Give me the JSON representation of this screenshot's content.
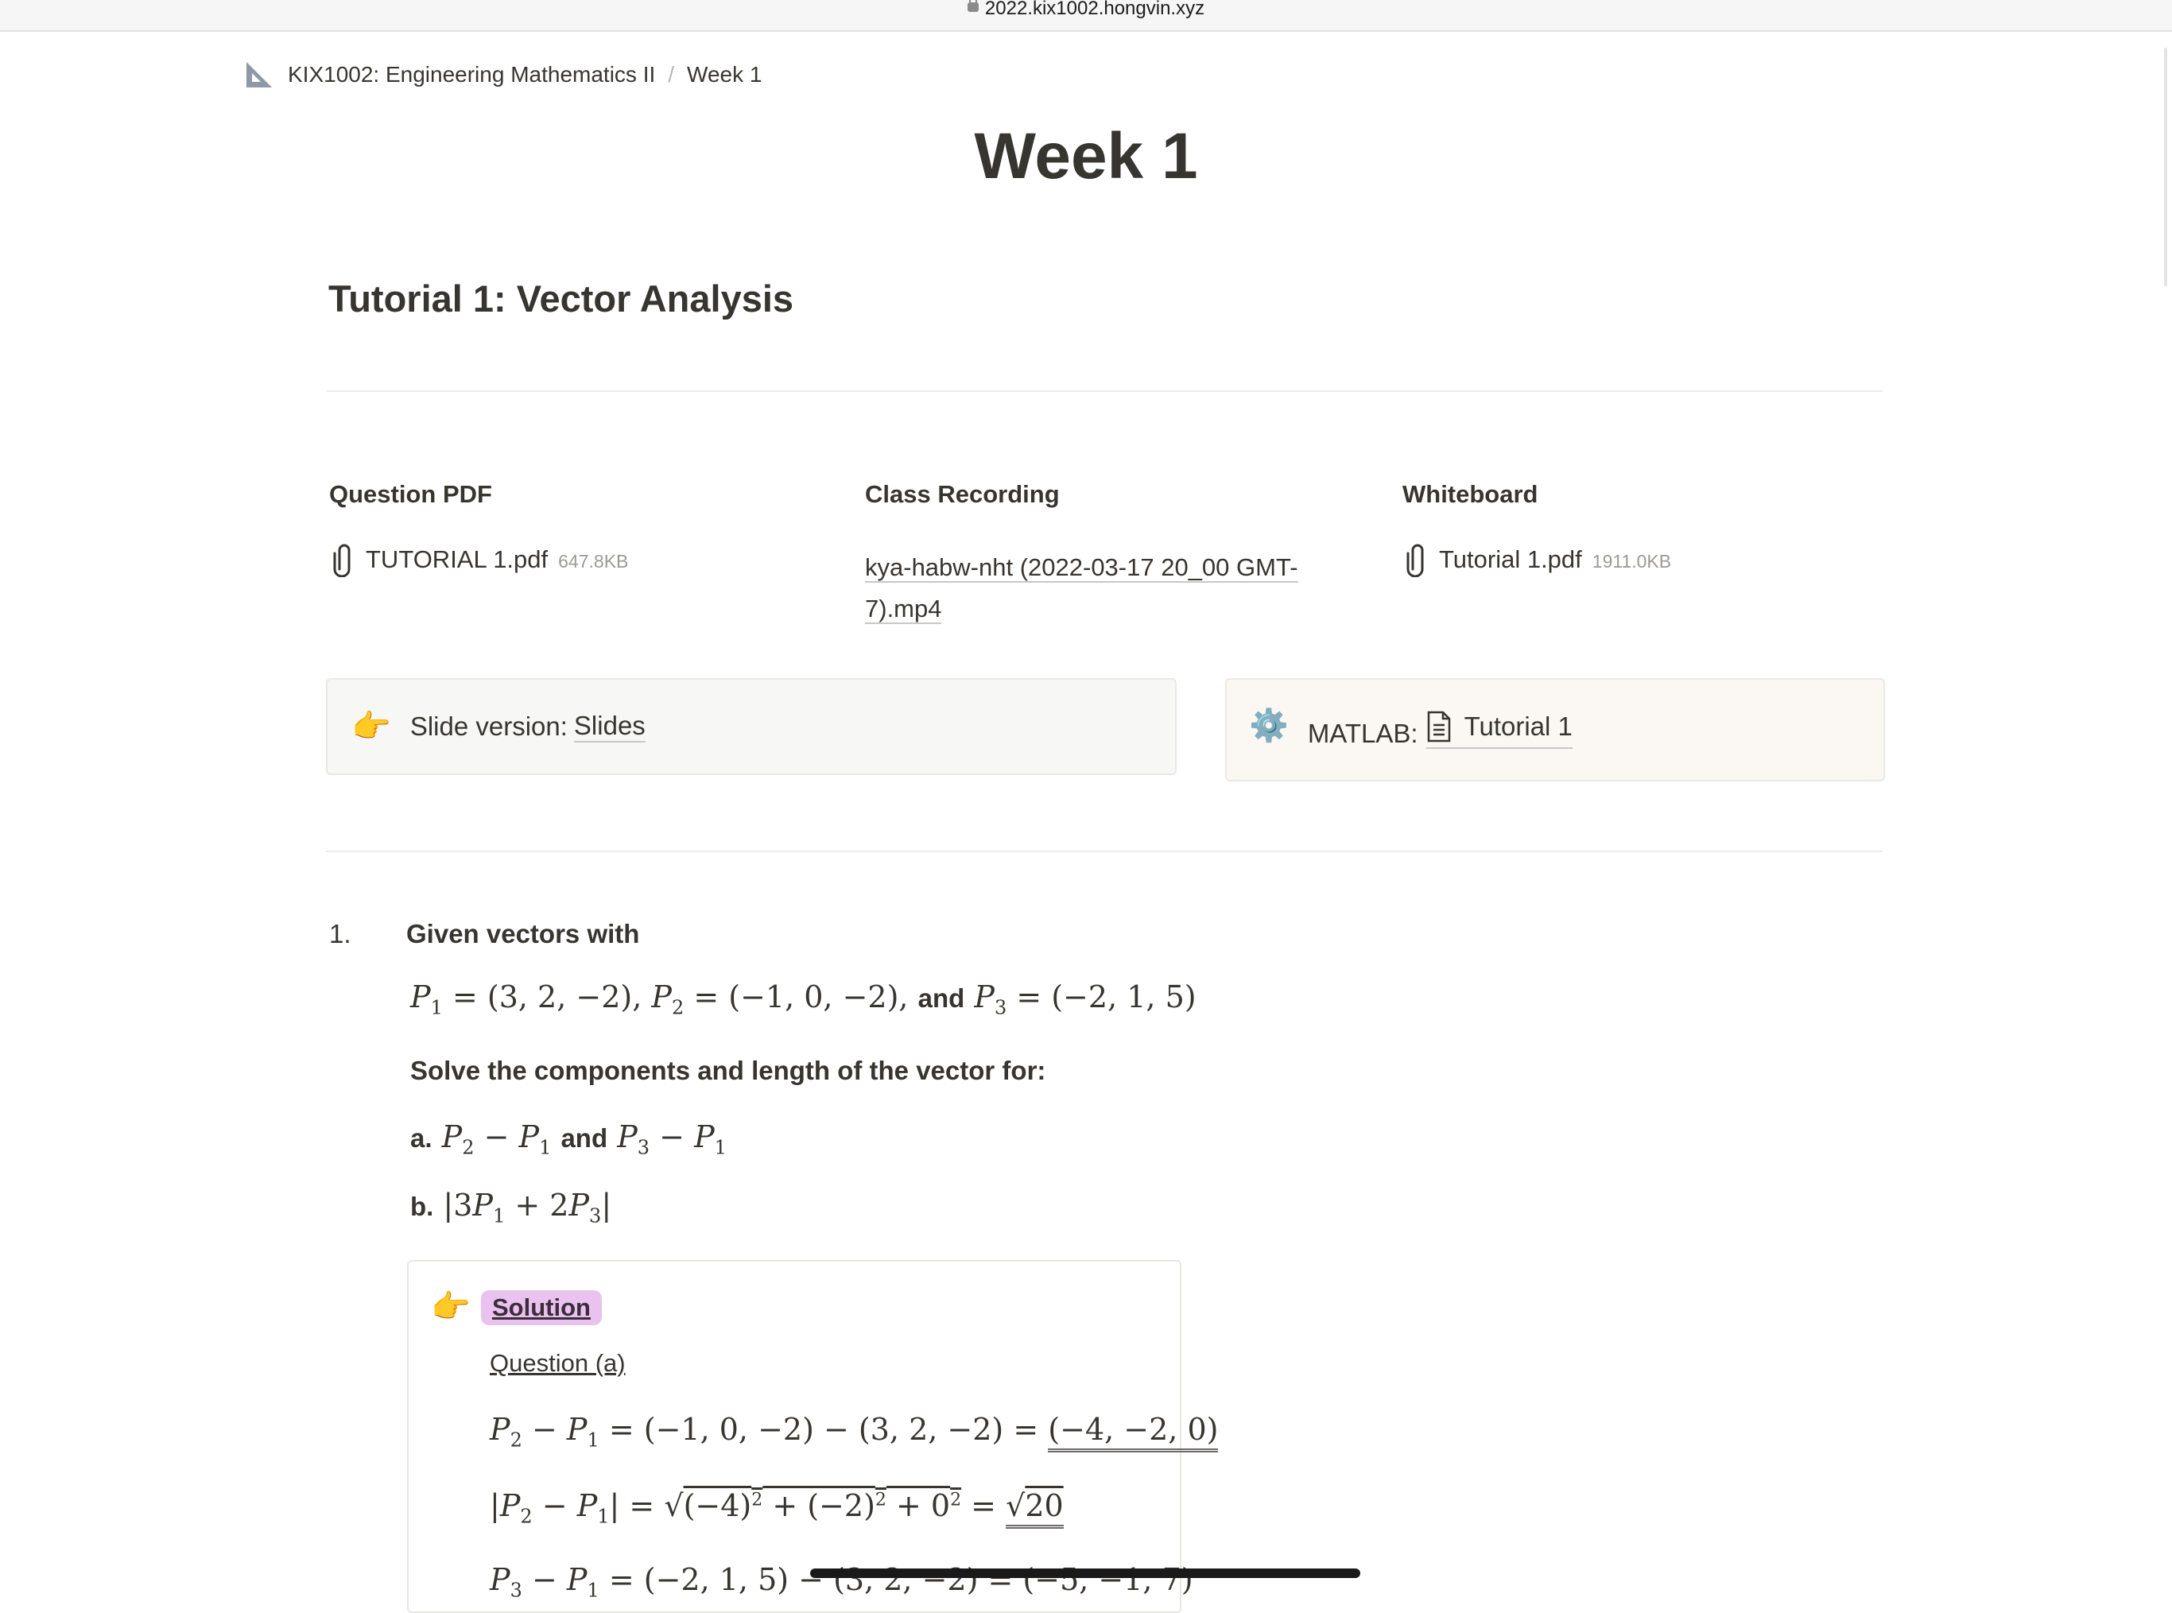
{
  "browser": {
    "url": "2022.kix1002.hongvin.xyz"
  },
  "breadcrumb": {
    "course": "KIX1002: Engineering Mathematics II",
    "separator": "/",
    "page": "Week 1"
  },
  "page_title": "Week 1",
  "tutorial_heading": "Tutorial 1: Vector Analysis",
  "columns": {
    "question": {
      "heading": "Question PDF",
      "file": "TUTORIAL 1.pdf",
      "size": "647.8KB"
    },
    "recording": {
      "heading": "Class Recording",
      "file": "kya-habw-nht (2022-03-17 20_00 GMT-7).mp4"
    },
    "whiteboard": {
      "heading": "Whiteboard",
      "file": "Tutorial 1.pdf",
      "size": "1911.0KB"
    }
  },
  "callouts": {
    "slides": {
      "emoji": "👉",
      "text": "Slide version: ",
      "link": "Slides"
    },
    "matlab": {
      "emoji": "⚙️",
      "text": "MATLAB: ",
      "link": "Tutorial 1"
    }
  },
  "question1": {
    "number": "1.",
    "intro": "Given vectors with",
    "and_word": "and",
    "instruction": "Solve the components and length of the vector for:",
    "part_a_label": "a.",
    "part_b_label": "b."
  },
  "solution": {
    "emoji": "👉",
    "label": "Solution",
    "question_a": "Question (a)"
  },
  "colors": {
    "solution_highlight": "#e9c2f0",
    "callout_slide_bg": "#f7f7f5",
    "callout_matlab_bg": "#fbf8f4"
  }
}
